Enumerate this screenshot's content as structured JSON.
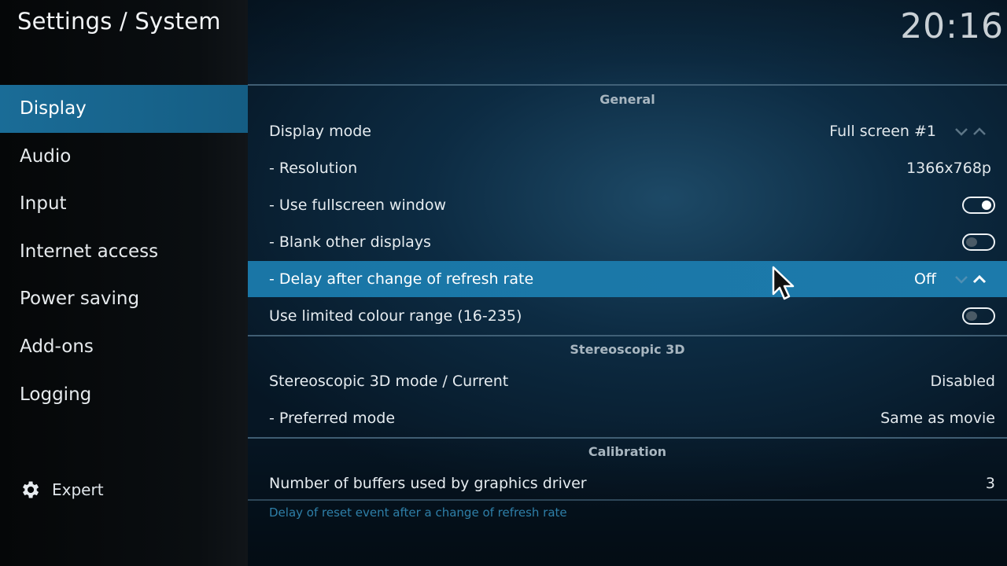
{
  "header": {
    "title": "Settings / System",
    "clock": "20:16"
  },
  "sidebar": {
    "items": [
      {
        "label": "Display",
        "active": true
      },
      {
        "label": "Audio",
        "active": false
      },
      {
        "label": "Input",
        "active": false
      },
      {
        "label": "Internet access",
        "active": false
      },
      {
        "label": "Power saving",
        "active": false
      },
      {
        "label": "Add-ons",
        "active": false
      },
      {
        "label": "Logging",
        "active": false
      }
    ],
    "level_label": "Expert",
    "level_icon": "gear-icon"
  },
  "sections": [
    {
      "title": "General",
      "rows": [
        {
          "label": "Display mode",
          "value": "Full screen #1",
          "control": "spinner"
        },
        {
          "label": "- Resolution",
          "value": "1366x768p",
          "control": "value"
        },
        {
          "label": "- Use fullscreen window",
          "value": "",
          "control": "toggle",
          "state": true
        },
        {
          "label": "- Blank other displays",
          "value": "",
          "control": "toggle",
          "state": false
        },
        {
          "label": "- Delay after change of refresh rate",
          "value": "Off",
          "control": "spinner",
          "focused": true
        },
        {
          "label": "Use limited colour range (16-235)",
          "value": "",
          "control": "toggle",
          "state": false
        }
      ]
    },
    {
      "title": "Stereoscopic 3D",
      "rows": [
        {
          "label": "Stereoscopic 3D mode / Current",
          "value": "Disabled",
          "control": "value"
        },
        {
          "label": "- Preferred mode",
          "value": "Same as movie",
          "control": "value"
        }
      ]
    },
    {
      "title": "Calibration",
      "rows": [
        {
          "label": "Number of buffers used by graphics driver",
          "value": "3",
          "control": "value"
        }
      ]
    }
  ],
  "hint": "Delay of reset event after a change of refresh rate",
  "colors": {
    "accent": "#1a76a6",
    "sidebar_active": "#1a6c97",
    "hint_text": "#2e7fa8"
  }
}
